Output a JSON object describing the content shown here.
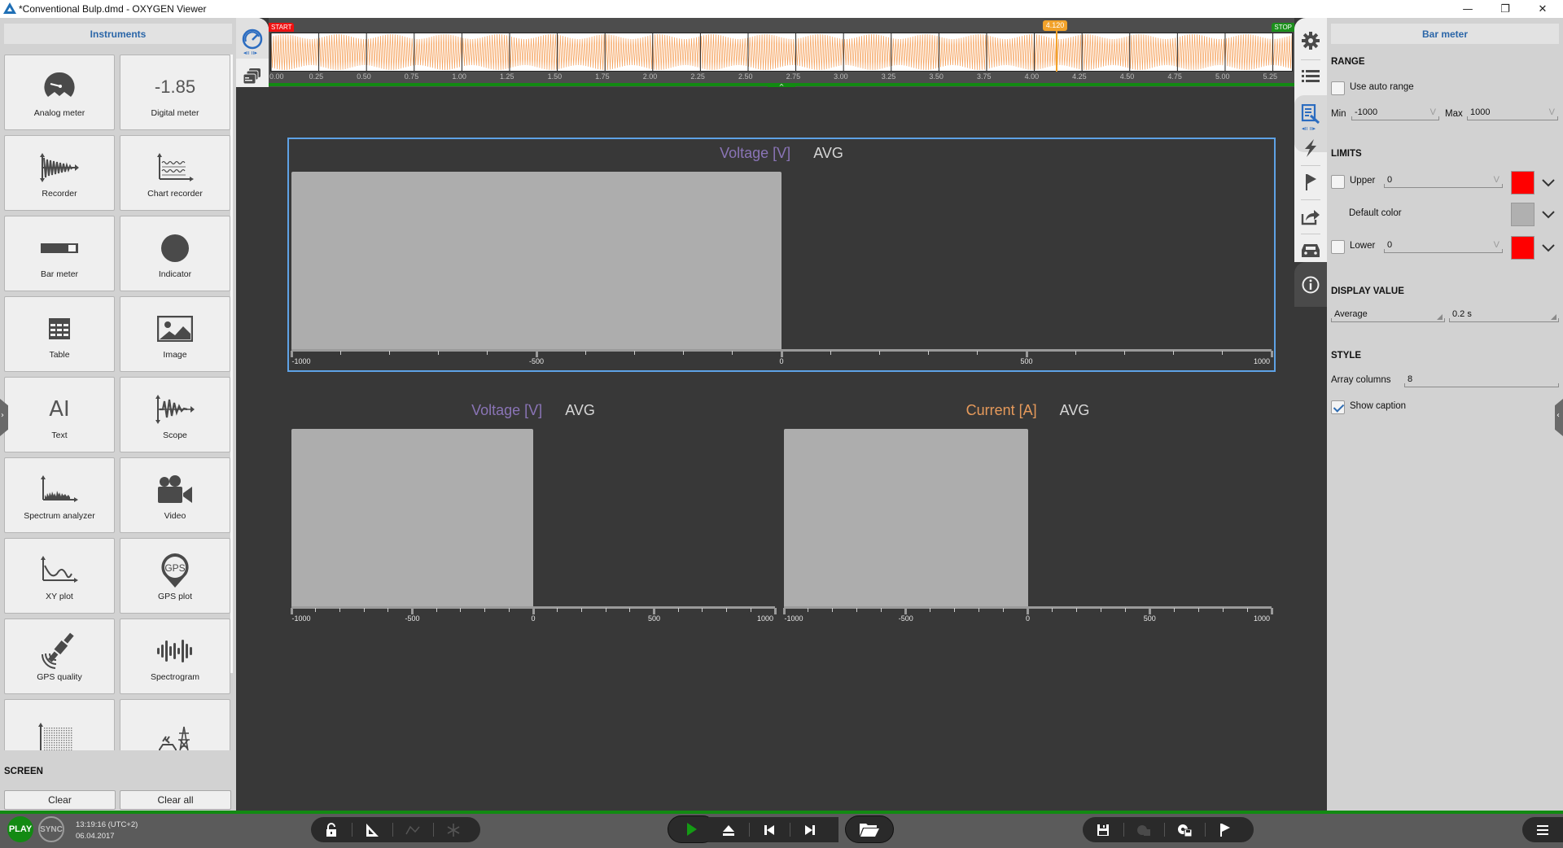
{
  "window": {
    "title": "*Conventional Bulp.dmd - OXYGEN Viewer",
    "controls": {
      "minimize": "—",
      "restore": "❐",
      "close": "✕"
    }
  },
  "instruments_panel": {
    "title": "Instruments",
    "items": [
      {
        "label": "Analog meter",
        "icon": "analog-meter-icon"
      },
      {
        "label": "Digital meter",
        "icon": "digital-meter-icon",
        "preview_value": "-1.85"
      },
      {
        "label": "Recorder",
        "icon": "recorder-icon"
      },
      {
        "label": "Chart recorder",
        "icon": "chart-recorder-icon"
      },
      {
        "label": "Bar meter",
        "icon": "bar-meter-icon"
      },
      {
        "label": "Indicator",
        "icon": "indicator-icon"
      },
      {
        "label": "Table",
        "icon": "table-icon"
      },
      {
        "label": "Image",
        "icon": "image-icon"
      },
      {
        "label": "Text",
        "icon": "text-icon",
        "glyph": "AI"
      },
      {
        "label": "Scope",
        "icon": "scope-icon"
      },
      {
        "label": "Spectrum analyzer",
        "icon": "spectrum-analyzer-icon"
      },
      {
        "label": "Video",
        "icon": "video-icon"
      },
      {
        "label": "XY plot",
        "icon": "xy-plot-icon"
      },
      {
        "label": "GPS plot",
        "icon": "gps-plot-icon",
        "glyph": "GPS"
      },
      {
        "label": "GPS quality",
        "icon": "gps-quality-icon"
      },
      {
        "label": "Spectrogram",
        "icon": "spectrogram-icon"
      },
      {
        "label": "",
        "icon": "matrix-plot-icon"
      },
      {
        "label": "",
        "icon": "power-ev-icon"
      }
    ],
    "screen_section": {
      "title": "SCREEN",
      "clear_label": "Clear",
      "clear_all_label": "Clear all"
    }
  },
  "left_tabs": [
    "instruments-tab",
    "screens-tab",
    "print-tab"
  ],
  "timeline": {
    "start_label": "START",
    "stop_label": "STOP",
    "cursor_label": "4.120",
    "cursor_value": 4.12,
    "range": [
      0,
      5.35
    ],
    "ticks": [
      "0.00",
      "0.25",
      "0.50",
      "0.75",
      "1.00",
      "1.25",
      "1.50",
      "1.75",
      "2.00",
      "2.25",
      "2.50",
      "2.75",
      "3.00",
      "3.25",
      "3.50",
      "3.75",
      "4.00",
      "4.25",
      "4.50",
      "4.75",
      "5.00",
      "5.25"
    ],
    "waveform_color": "#f5a25d",
    "collapse_glyph": "^"
  },
  "bar_meters": [
    {
      "channel": "Voltage [V]",
      "aggregation": "AVG",
      "channel_color": "#8a74b6",
      "min": -1000,
      "max": 1000,
      "value": 0,
      "selected": true,
      "tick_labels": [
        "-1000",
        "-500",
        "0",
        "500",
        "1000"
      ]
    },
    {
      "channel": "Voltage [V]",
      "aggregation": "AVG",
      "channel_color": "#8a74b6",
      "min": -1000,
      "max": 1000,
      "value": 0,
      "selected": false,
      "tick_labels": [
        "-1000",
        "-500",
        "0",
        "500",
        "1000"
      ]
    },
    {
      "channel": "Current [A]",
      "aggregation": "AVG",
      "channel_color": "#e69a5b",
      "min": -1000,
      "max": 1000,
      "value": 0,
      "selected": false,
      "tick_labels": [
        "-1000",
        "-500",
        "0",
        "500",
        "1000"
      ]
    }
  ],
  "right_tabs": [
    "settings-tab",
    "channel-list-tab",
    "instrument-properties-tab",
    "triggers-tab",
    "markers-tab",
    "export-tab",
    "vehicle-tab",
    "info-tab"
  ],
  "properties_panel": {
    "title": "Bar meter",
    "range": {
      "section": "RANGE",
      "auto_range_label": "Use auto range",
      "auto_range_checked": false,
      "min_label": "Min",
      "min_value": "-1000",
      "max_label": "Max",
      "max_value": "1000",
      "unit": "V"
    },
    "limits": {
      "section": "LIMITS",
      "upper_label": "Upper",
      "upper_checked": false,
      "upper_value": "0",
      "upper_color": "#ff0000",
      "default_color_label": "Default color",
      "default_color": "#b0b0b0",
      "lower_label": "Lower",
      "lower_checked": false,
      "lower_value": "0",
      "lower_color": "#ff0000",
      "unit": "V"
    },
    "display_value": {
      "section": "DISPLAY VALUE",
      "mode": "Average",
      "interval": "0.2 s"
    },
    "style": {
      "section": "STYLE",
      "array_columns_label": "Array columns",
      "array_columns_value": "8",
      "show_caption_label": "Show caption",
      "show_caption_checked": true
    }
  },
  "status_bar": {
    "play_label": "PLAY",
    "sync_label": "SYNC",
    "time": "13:19:16 (UTC+2)",
    "date": "06.04.2017",
    "colors": {
      "play": "#138a13",
      "accent": "#128a12"
    }
  }
}
